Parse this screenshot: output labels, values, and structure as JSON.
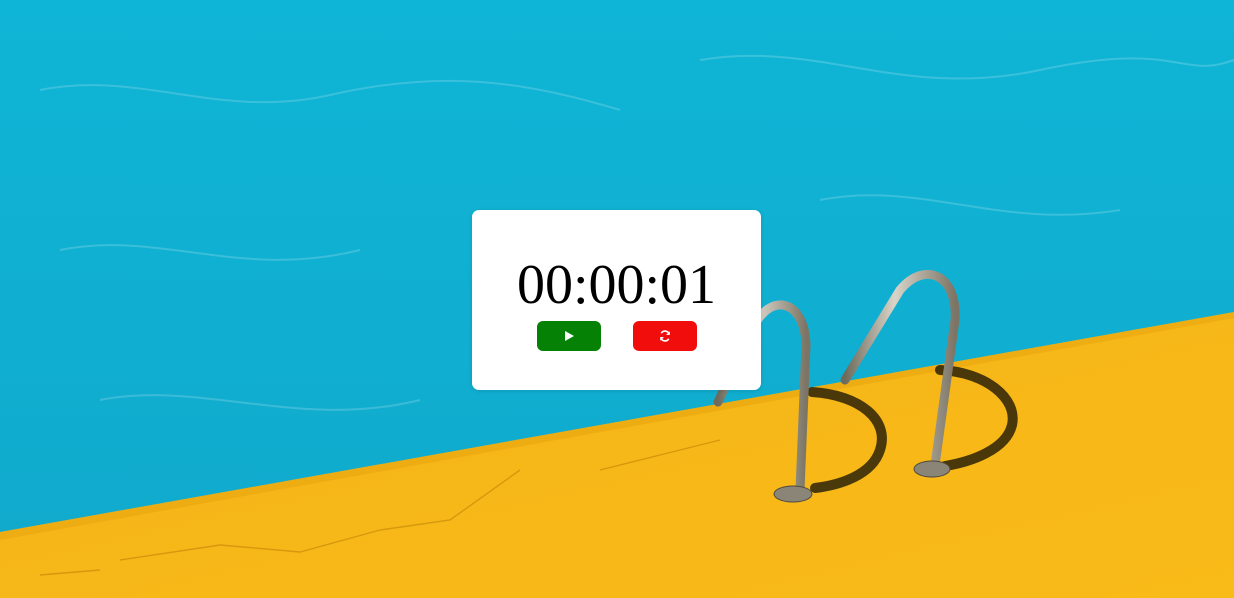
{
  "timer": {
    "display": "00:00:01"
  },
  "controls": {
    "start": {
      "icon": "play-icon",
      "color": "#058105"
    },
    "reset": {
      "icon": "refresh-icon",
      "color": "#f20d0d"
    }
  },
  "background": {
    "water_color": "#11b3d3",
    "deck_color": "#f7b614"
  }
}
